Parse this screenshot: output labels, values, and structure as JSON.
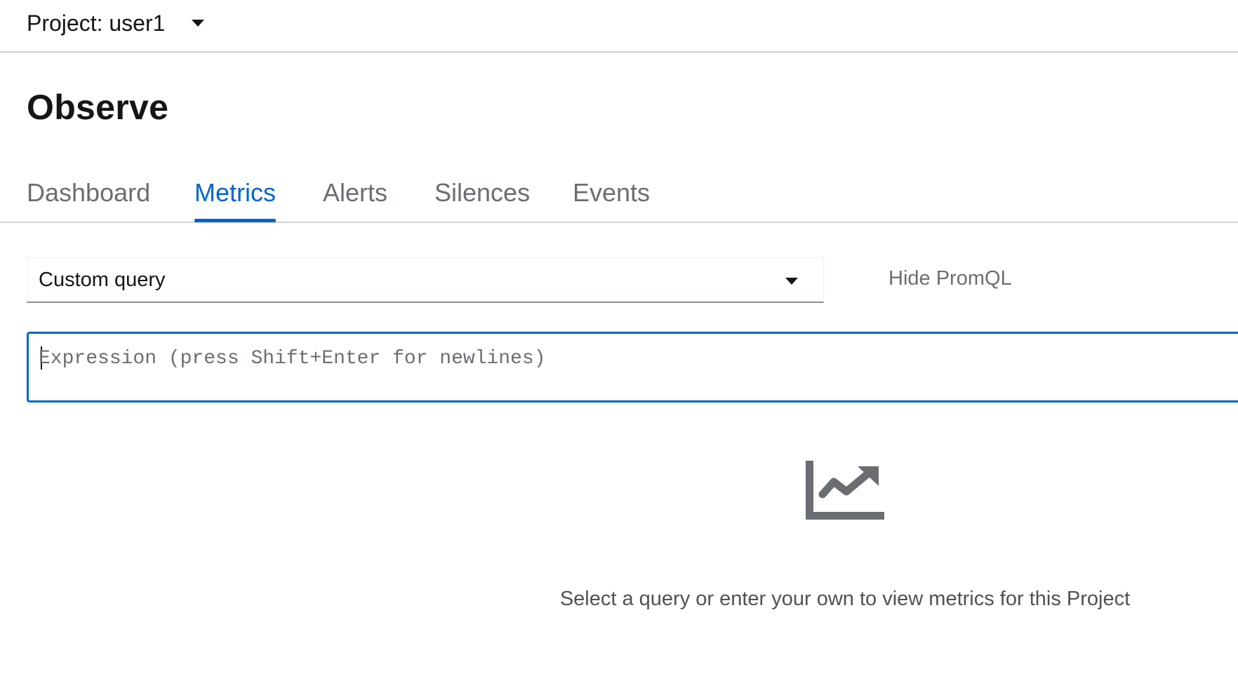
{
  "project": {
    "label": "Project: user1"
  },
  "page": {
    "title": "Observe"
  },
  "tabs": [
    {
      "label": "Dashboard",
      "active": false
    },
    {
      "label": "Metrics",
      "active": true
    },
    {
      "label": "Alerts",
      "active": false
    },
    {
      "label": "Silences",
      "active": false
    },
    {
      "label": "Events",
      "active": false
    }
  ],
  "query": {
    "selected": "Custom query",
    "hide_promql_label": "Hide PromQL",
    "expression_placeholder": "Expression (press Shift+Enter for newlines)",
    "expression_value": ""
  },
  "empty_state": {
    "icon": "chart-area-icon",
    "message": "Select a query or enter your own to view metrics for this Project"
  },
  "colors": {
    "accent": "#0066cc",
    "text": "#151515",
    "muted": "#6a6e73",
    "icon": "#6a6e73",
    "border": "#d2d2d2"
  }
}
